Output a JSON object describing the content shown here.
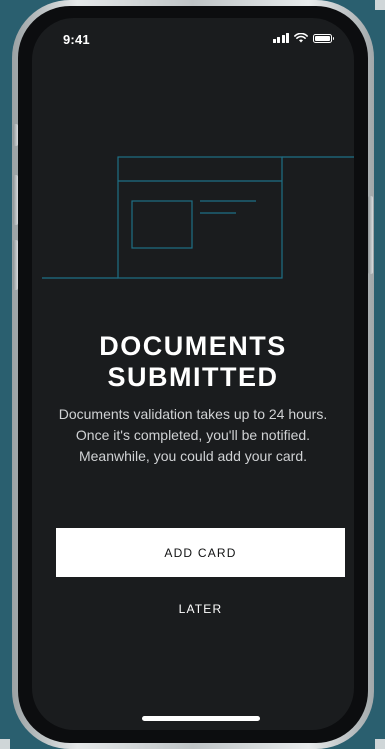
{
  "status_bar": {
    "time": "9:41",
    "icons": [
      "signal-icon",
      "wifi-icon",
      "battery-icon"
    ]
  },
  "content": {
    "title_line_1": "DOCUMENTS",
    "title_line_2": "SUBMITTED",
    "message": "Documents validation takes up to 24 hours. Once it's completed, you'll be notified. Meanwhile, you could add your card."
  },
  "actions": {
    "primary_label": "ADD CARD",
    "secondary_label": "LATER"
  },
  "colors": {
    "background": "#2a5f6f",
    "screen": "#1a1c1e",
    "illustration_stroke": "#1e6f86",
    "button": "#ffffff"
  }
}
